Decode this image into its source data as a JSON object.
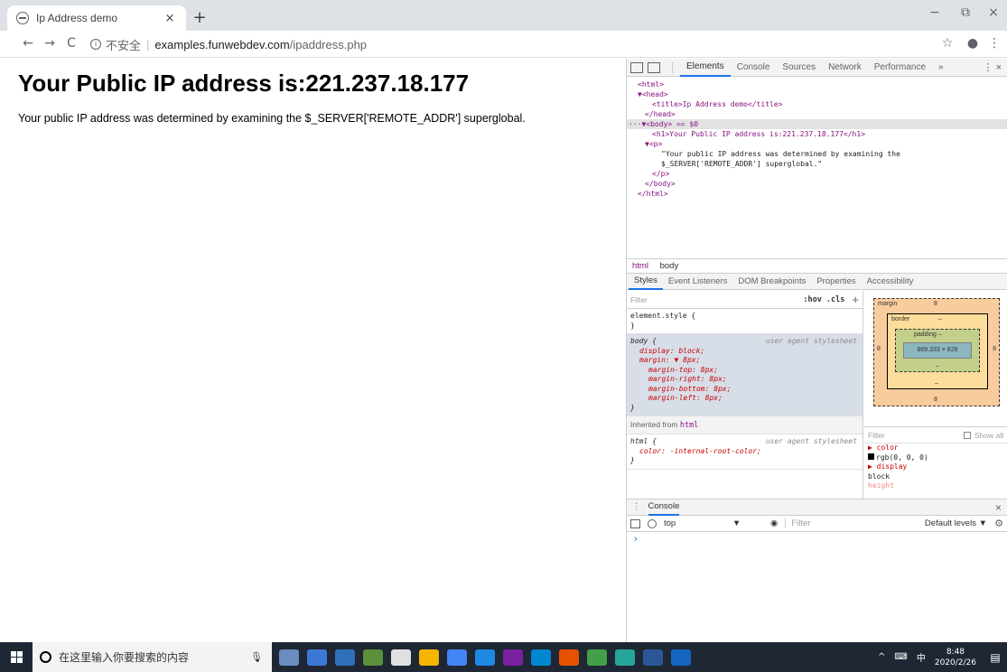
{
  "browser": {
    "tab_title": "Ip Address demo",
    "tab_close": "×",
    "new_tab": "+",
    "win_min": "−",
    "win_restore": "⧉",
    "win_close": "×",
    "nav_back": "←",
    "nav_forward": "→",
    "nav_reload": "C",
    "info_glyph": "i",
    "insecure_label": "不安全",
    "separator": "|",
    "url_host": "examples.funwebdev.com",
    "url_path": "/ipaddress.php",
    "star_glyph": "☆",
    "account_glyph": "●",
    "menu_glyph": "⋮"
  },
  "page": {
    "heading": "Your Public IP address is:221.237.18.177",
    "paragraph": "Your public IP address was determined by examining the $_SERVER['REMOTE_ADDR'] superglobal."
  },
  "devtools": {
    "tabs": [
      "Elements",
      "Console",
      "Sources",
      "Network",
      "Performance",
      "»"
    ],
    "more": "⋮  ×",
    "dom_lines": [
      "<html>",
      "▼<head>",
      "<title>Ip Address demo</title>",
      "</head>",
      "···▼<body> == $0",
      "<h1>Your Public IP address is:221.237.18.177</h1>",
      "▼<p>",
      "\"Your public IP address was determined by examining the",
      "$_SERVER['REMOTE_ADDR'] superglobal.\"",
      "</p>",
      "</body>",
      "</html>"
    ],
    "breadcrumbs": [
      "html",
      "body"
    ],
    "subtabs": [
      "Styles",
      "Event Listeners",
      "DOM Breakpoints",
      "Properties",
      "Accessibility"
    ],
    "styles_filter_placeholder": "Filter",
    "hov_cls": ":hov  .cls",
    "plus": "+",
    "element_style_open": "element.style {",
    "element_style_close": "}",
    "body_rule": {
      "selector": "body {",
      "source": "user agent stylesheet",
      "props": [
        "display: block;",
        "margin: ▼ 8px;"
      ],
      "subprops": [
        "margin-top: 8px;",
        "margin-right: 8px;",
        "margin-bottom: 8px;",
        "margin-left: 8px;"
      ],
      "close": "}"
    },
    "inherited_label": "Inherited from",
    "inherited_tag": "html",
    "html_rule": {
      "selector": "html {",
      "source": "user agent stylesheet",
      "prop": "color: -internal-root-color;",
      "close": "}"
    },
    "boxmodel": {
      "margin_label": "margin",
      "margin_value": "8",
      "border_label": "border",
      "border_value": "–",
      "padding_label": "padding –",
      "content": "869.333 × 826",
      "dash": "–",
      "bottom_margin": "8",
      "side": "8"
    },
    "computed": {
      "filter": "Filter",
      "show_all": "Show all",
      "lines": [
        "▶ color",
        "rgb(0, 0, 0)",
        "▶ display",
        "block",
        "height"
      ]
    },
    "console": {
      "dots": "⋮",
      "tab": "Console",
      "close": "×",
      "context": "top",
      "context_arrow": "▼",
      "eye": "◉",
      "filter": "Filter",
      "levels": "Default levels ▼",
      "gear": "⚙",
      "prompt": "›"
    }
  },
  "taskbar": {
    "search_placeholder": "在这里输入你要搜索的内容",
    "mic": "🎙",
    "time": "8:48",
    "date": "2020/2/26",
    "ime": "中",
    "tray_caret": "^",
    "notif": "▤",
    "app_colors": [
      "#6b8cbf",
      "#3b78d8",
      "#2f6fba",
      "#5b8f3a",
      "#e0e0e0",
      "#f4b400",
      "#4285f4",
      "#1e88e5",
      "#7b1fa2",
      "#0288d1",
      "#e65100",
      "#43a047",
      "#26a69a",
      "#2b5797",
      "#1565c0"
    ]
  }
}
